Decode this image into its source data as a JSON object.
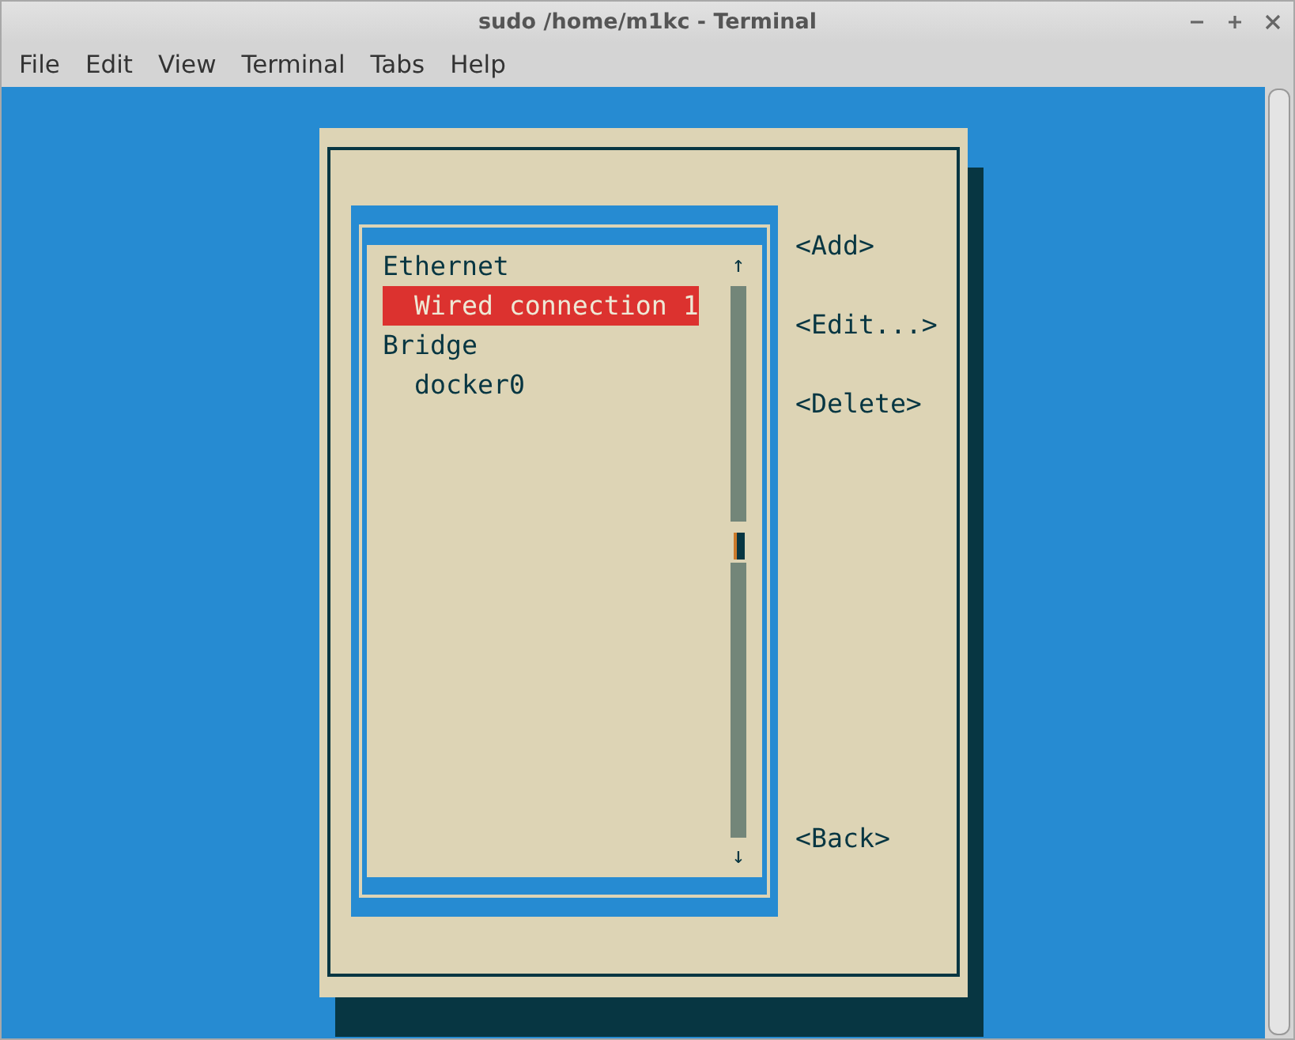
{
  "window": {
    "title": "sudo /home/m1kc - Terminal"
  },
  "menu": [
    "File",
    "Edit",
    "View",
    "Terminal",
    "Tabs",
    "Help"
  ],
  "connections": {
    "items": [
      {
        "label": "Ethernet",
        "selected": false,
        "children": [
          {
            "label": "Wired connection 1",
            "selected": true
          }
        ]
      },
      {
        "label": "Bridge",
        "selected": false,
        "children": [
          {
            "label": "docker0",
            "selected": false
          }
        ]
      }
    ],
    "scroll_up": "↑",
    "scroll_down": "↓"
  },
  "buttons": [
    "<Add>",
    "<Edit...>",
    "<Delete>"
  ],
  "back_button": "<Back>"
}
